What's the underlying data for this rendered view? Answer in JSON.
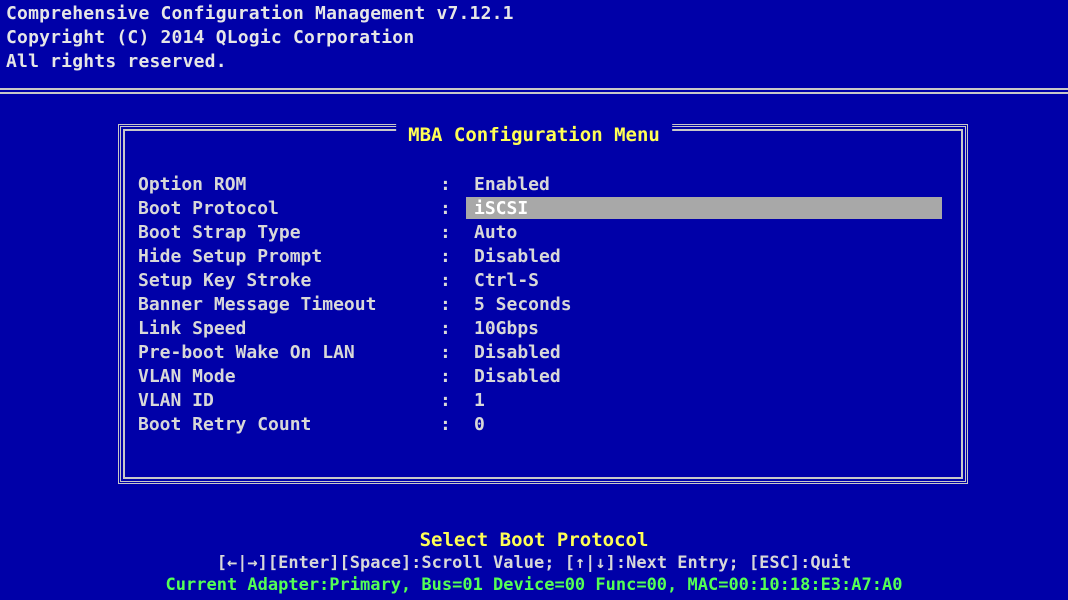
{
  "header": {
    "line1": "Comprehensive Configuration Management v7.12.1",
    "line2": "Copyright (C) 2014 QLogic Corporation",
    "line3": "All rights reserved."
  },
  "menu": {
    "title": "MBA Configuration Menu",
    "colon": ":",
    "items": [
      {
        "label": "Option ROM",
        "value": "Enabled"
      },
      {
        "label": "Boot Protocol",
        "value": "iSCSI"
      },
      {
        "label": "Boot Strap Type",
        "value": "Auto"
      },
      {
        "label": "Hide Setup Prompt",
        "value": "Disabled"
      },
      {
        "label": "Setup Key Stroke",
        "value": "Ctrl-S"
      },
      {
        "label": "Banner Message Timeout",
        "value": "5 Seconds"
      },
      {
        "label": "Link Speed",
        "value": "10Gbps"
      },
      {
        "label": "Pre-boot Wake On LAN",
        "value": "Disabled"
      },
      {
        "label": "VLAN Mode",
        "value": "Disabled"
      },
      {
        "label": "VLAN ID",
        "value": "1"
      },
      {
        "label": "Boot Retry Count",
        "value": "0"
      }
    ],
    "selected_index": 1
  },
  "footer": {
    "help_title": "Select Boot Protocol",
    "keys": "[←|→][Enter][Space]:Scroll Value; [↑|↓]:Next Entry; [ESC]:Quit",
    "adapter": "Current Adapter:Primary, Bus=01 Device=00 Func=00, MAC=00:10:18:E3:A7:A0"
  },
  "colors": {
    "background": "#0000a8",
    "text": "#d8d8d8",
    "title": "#ffff54",
    "adapter": "#54ff54",
    "selection": "#a8a8a8"
  }
}
